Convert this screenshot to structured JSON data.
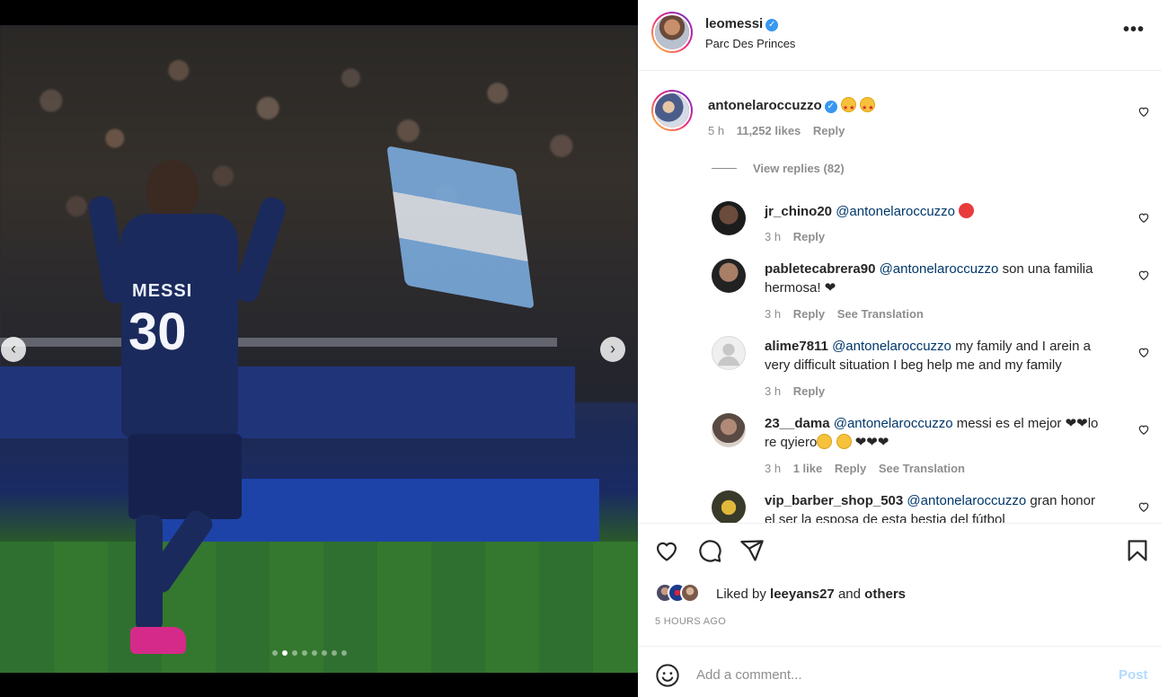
{
  "post": {
    "username": "leomessi",
    "location": "Parc Des Princes",
    "more_label": "•••",
    "carousel": {
      "prev_label": "‹",
      "next_label": "›",
      "total_slides": 8,
      "active_slide": 2,
      "jersey_name": "MESSI",
      "jersey_number": "30"
    }
  },
  "comments": [
    {
      "username": "antonelaroccuzzo",
      "verified": true,
      "text": "",
      "time": "5 h",
      "likes": "11,252 likes",
      "reply": "Reply",
      "view_replies": "View replies (82)"
    },
    {
      "username": "jr_chino20",
      "mention": "@antonelaroccuzzo",
      "text": "",
      "time": "3 h",
      "reply": "Reply"
    },
    {
      "username": "pabletecabrera90",
      "mention": "@antonelaroccuzzo",
      "text": "son una familia",
      "text2": "hermosa! ❤",
      "time": "3 h",
      "reply": "Reply",
      "translate": "See Translation"
    },
    {
      "username": "alime7811",
      "mention": "@antonelaroccuzzo",
      "text": "my family and I arein a",
      "text2": "very difficult situation I beg help me and my family",
      "time": "3 h",
      "reply": "Reply"
    },
    {
      "username": "23__dama",
      "mention": "@antonelaroccuzzo",
      "text": "messi es el mejor ❤❤lo",
      "text2": "re qyiero",
      "text3": "❤❤❤",
      "time": "3 h",
      "likes": "1 like",
      "reply": "Reply",
      "translate": "See Translation"
    },
    {
      "username": "vip_barber_shop_503",
      "mention": "@antonelaroccuzzo",
      "text": "gran honor",
      "text2": "el ser la esposa de esta bestia del fútbol"
    }
  ],
  "footer": {
    "liked_by_prefix": "Liked by",
    "liked_by_user": "leeyans27",
    "liked_by_and": "and",
    "liked_by_others": "others",
    "time_ago": "5 HOURS AGO",
    "comment_placeholder": "Add a comment...",
    "post_label": "Post"
  },
  "colors": {
    "verified": "#3897f0",
    "mention": "#00376b",
    "secondary_text": "#8e8e8e",
    "post_button_disabled": "#b3dbff"
  },
  "icons": [
    "heart-icon",
    "comment-icon",
    "share-icon",
    "bookmark-icon",
    "smiley-icon",
    "verified-badge-icon",
    "more-options-icon",
    "chevron-left-icon",
    "chevron-right-icon"
  ]
}
